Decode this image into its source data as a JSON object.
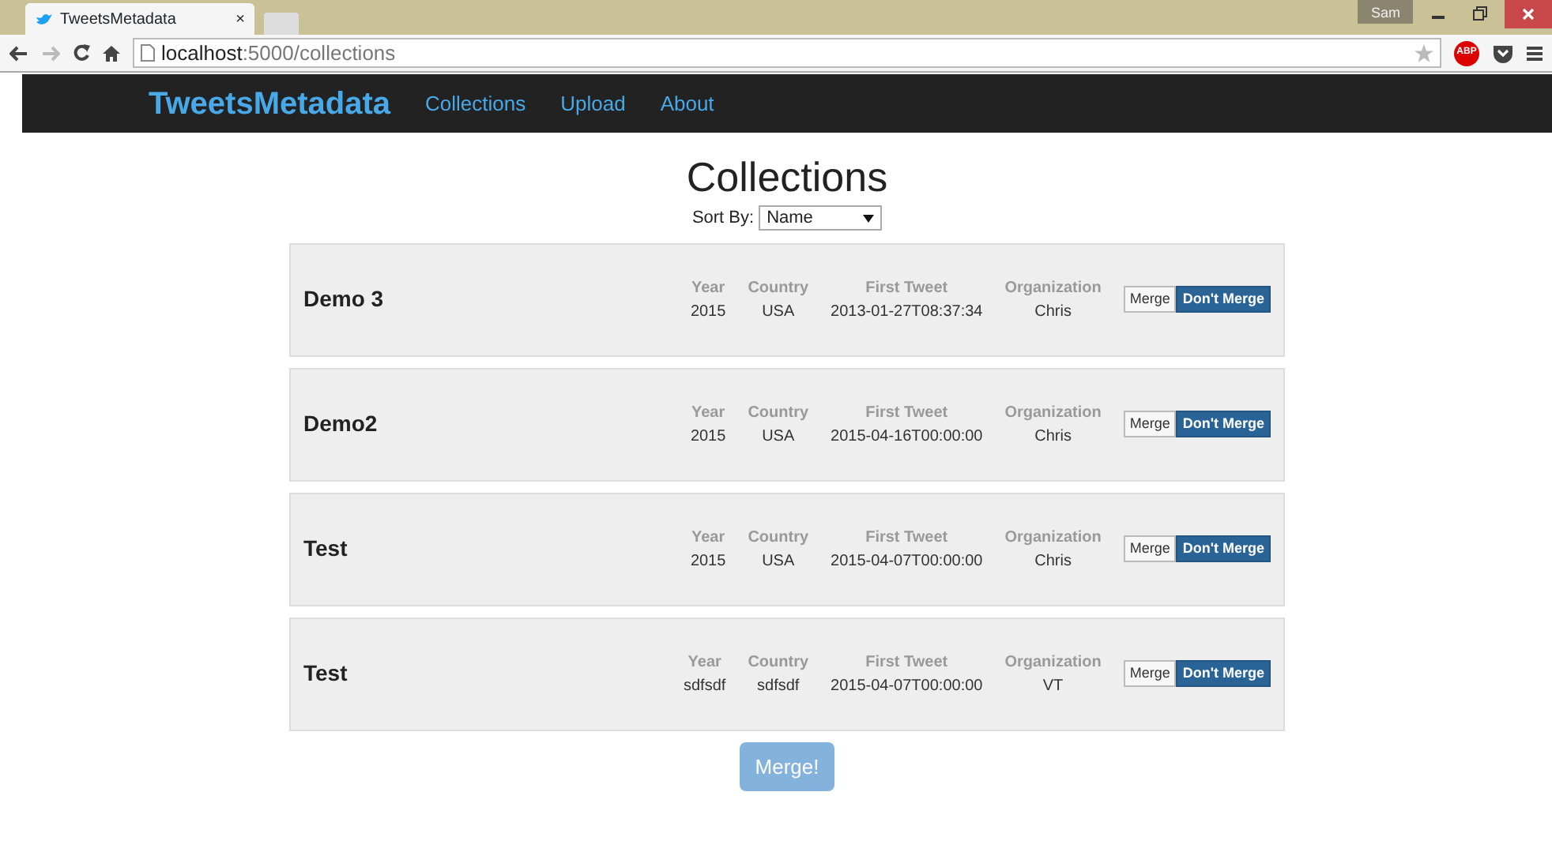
{
  "browser": {
    "tab_title": "TweetsMetadata",
    "tab_close": "×",
    "user": "Sam",
    "address_host": "localhost",
    "address_path": ":5000/collections",
    "extension_label": "ABP"
  },
  "navbar": {
    "brand": "TweetsMetadata",
    "links": [
      {
        "label": "Collections"
      },
      {
        "label": "Upload"
      },
      {
        "label": "About"
      }
    ]
  },
  "heading": "Collections",
  "sort": {
    "label": "Sort By:",
    "value": "Name"
  },
  "collections": [
    {
      "name": "Demo 3",
      "fields": [
        {
          "label": "Year",
          "value": "2015"
        },
        {
          "label": "Country",
          "value": "USA"
        },
        {
          "label": "First Tweet",
          "value": "2013-01-27T08:37:34"
        },
        {
          "label": "Organization",
          "value": "Chris"
        }
      ],
      "merge_label": "Merge",
      "dont_merge_label": "Don't Merge",
      "merge": false
    },
    {
      "name": "Demo2",
      "fields": [
        {
          "label": "Year",
          "value": "2015"
        },
        {
          "label": "Country",
          "value": "USA"
        },
        {
          "label": "First Tweet",
          "value": "2015-04-16T00:00:00"
        },
        {
          "label": "Organization",
          "value": "Chris"
        }
      ],
      "merge_label": "Merge",
      "dont_merge_label": "Don't Merge",
      "merge": false
    },
    {
      "name": "Test",
      "fields": [
        {
          "label": "Year",
          "value": "2015"
        },
        {
          "label": "Country",
          "value": "USA"
        },
        {
          "label": "First Tweet",
          "value": "2015-04-07T00:00:00"
        },
        {
          "label": "Organization",
          "value": "Chris"
        }
      ],
      "merge_label": "Merge",
      "dont_merge_label": "Don't Merge",
      "merge": false
    },
    {
      "name": "Test",
      "fields": [
        {
          "label": "Year",
          "value": "sdfsdf"
        },
        {
          "label": "Country",
          "value": "sdfsdf"
        },
        {
          "label": "First Tweet",
          "value": "2015-04-07T00:00:00"
        },
        {
          "label": "Organization",
          "value": "VT"
        }
      ],
      "merge_label": "Merge",
      "dont_merge_label": "Don't Merge",
      "merge": false
    }
  ],
  "merge_button": {
    "label": "Merge!",
    "disabled": true
  }
}
